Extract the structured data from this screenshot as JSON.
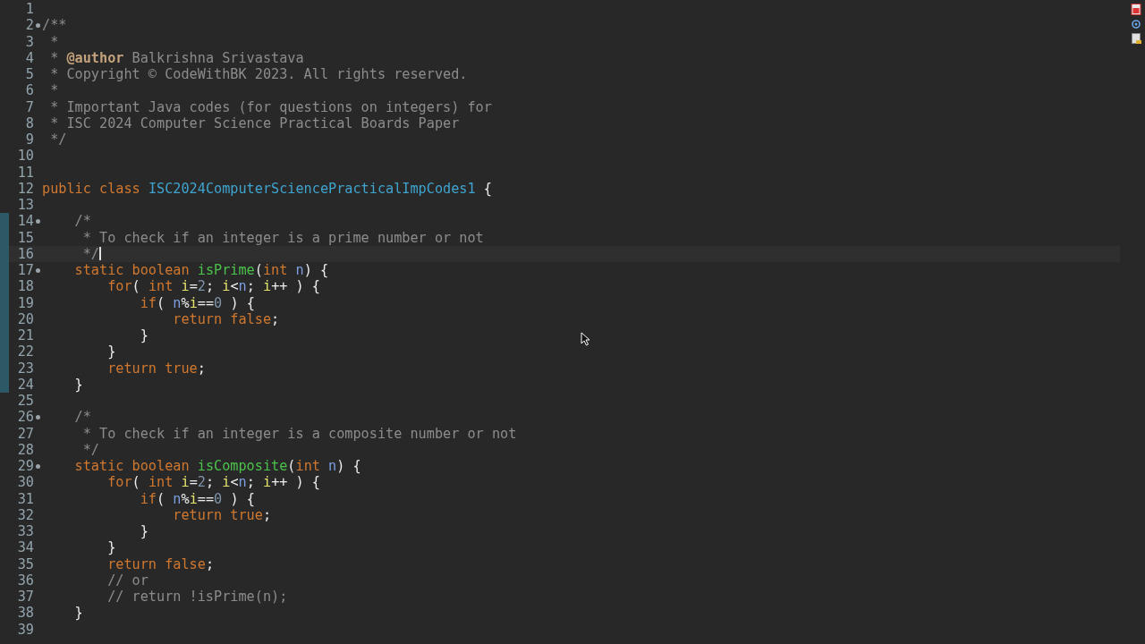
{
  "editor": {
    "lines": [
      {
        "number": "1",
        "fold": false,
        "changed": false,
        "current": false
      },
      {
        "number": "2",
        "tokens": [
          {
            "kind": "comment",
            "text": "/**"
          }
        ],
        "fold": true,
        "changed": false,
        "current": false
      },
      {
        "number": "3",
        "tokens": [
          {
            "kind": "comment",
            "text": " *"
          }
        ],
        "fold": false,
        "changed": false,
        "current": false
      },
      {
        "number": "4",
        "tokens": [
          {
            "kind": "comment",
            "text": " * "
          },
          {
            "kind": "tag",
            "text": "@author"
          },
          {
            "kind": "comment",
            "text": " Balkrishna Srivastava"
          }
        ],
        "fold": false,
        "changed": false,
        "current": false
      },
      {
        "number": "5",
        "tokens": [
          {
            "kind": "comment",
            "text": " * Copyright © CodeWithBK 2023. All rights reserved."
          }
        ],
        "fold": false,
        "changed": false,
        "current": false
      },
      {
        "number": "6",
        "tokens": [
          {
            "kind": "comment",
            "text": " *"
          }
        ],
        "fold": false,
        "changed": false,
        "current": false
      },
      {
        "number": "7",
        "tokens": [
          {
            "kind": "comment",
            "text": " * Important Java codes (for questions on integers) for"
          }
        ],
        "fold": false,
        "changed": false,
        "current": false
      },
      {
        "number": "8",
        "tokens": [
          {
            "kind": "comment",
            "text": " * ISC 2024 Computer Science Practical Boards Paper"
          }
        ],
        "fold": false,
        "changed": false,
        "current": false
      },
      {
        "number": "9",
        "tokens": [
          {
            "kind": "comment",
            "text": " */"
          }
        ],
        "fold": false,
        "changed": false,
        "current": false
      },
      {
        "number": "10",
        "fold": false,
        "changed": false,
        "current": false
      },
      {
        "number": "11",
        "fold": false,
        "changed": false,
        "current": false
      },
      {
        "number": "12",
        "tokens": [
          {
            "kind": "keyword",
            "text": "public class "
          },
          {
            "kind": "class",
            "text": "ISC2024ComputerSciencePracticalImpCodes1"
          },
          {
            "kind": "plain",
            "text": " {"
          }
        ],
        "fold": false,
        "changed": false,
        "current": false
      },
      {
        "number": "13",
        "fold": false,
        "changed": false,
        "current": false
      },
      {
        "number": "14",
        "tokens": [
          {
            "kind": "comment",
            "text": "    /*"
          }
        ],
        "fold": true,
        "changed": true,
        "current": false
      },
      {
        "number": "15",
        "tokens": [
          {
            "kind": "comment",
            "text": "     * To check if an integer is a prime number or not"
          }
        ],
        "fold": false,
        "changed": true,
        "current": false
      },
      {
        "number": "16",
        "tokens": [
          {
            "kind": "comment",
            "text": "     */"
          }
        ],
        "fold": false,
        "changed": true,
        "current": true
      },
      {
        "number": "17",
        "tokens": [
          {
            "kind": "keyword",
            "text": "    static boolean "
          },
          {
            "kind": "method",
            "text": "isPrime"
          },
          {
            "kind": "plain",
            "text": "("
          },
          {
            "kind": "keyword",
            "text": "int "
          },
          {
            "kind": "param",
            "text": "n"
          },
          {
            "kind": "plain",
            "text": ") {"
          }
        ],
        "fold": true,
        "changed": true,
        "current": false
      },
      {
        "number": "18",
        "tokens": [
          {
            "kind": "keyword",
            "text": "        for"
          },
          {
            "kind": "plain",
            "text": "( "
          },
          {
            "kind": "keyword",
            "text": "int "
          },
          {
            "kind": "local",
            "text": "i"
          },
          {
            "kind": "plain",
            "text": "="
          },
          {
            "kind": "number",
            "text": "2"
          },
          {
            "kind": "plain",
            "text": "; "
          },
          {
            "kind": "local",
            "text": "i"
          },
          {
            "kind": "plain",
            "text": "<"
          },
          {
            "kind": "param",
            "text": "n"
          },
          {
            "kind": "plain",
            "text": "; "
          },
          {
            "kind": "local",
            "text": "i"
          },
          {
            "kind": "plain",
            "text": "++ ) {"
          }
        ],
        "fold": false,
        "changed": true,
        "current": false
      },
      {
        "number": "19",
        "tokens": [
          {
            "kind": "keyword",
            "text": "            if"
          },
          {
            "kind": "plain",
            "text": "( "
          },
          {
            "kind": "param",
            "text": "n"
          },
          {
            "kind": "plain",
            "text": "%"
          },
          {
            "kind": "local",
            "text": "i"
          },
          {
            "kind": "plain",
            "text": "=="
          },
          {
            "kind": "number",
            "text": "0"
          },
          {
            "kind": "plain",
            "text": " ) {"
          }
        ],
        "fold": false,
        "changed": true,
        "current": false
      },
      {
        "number": "20",
        "tokens": [
          {
            "kind": "keyword",
            "text": "                return false"
          },
          {
            "kind": "plain",
            "text": ";"
          }
        ],
        "fold": false,
        "changed": true,
        "current": false
      },
      {
        "number": "21",
        "tokens": [
          {
            "kind": "plain",
            "text": "            }"
          }
        ],
        "fold": false,
        "changed": true,
        "current": false
      },
      {
        "number": "22",
        "tokens": [
          {
            "kind": "plain",
            "text": "        }"
          }
        ],
        "fold": false,
        "changed": true,
        "current": false
      },
      {
        "number": "23",
        "tokens": [
          {
            "kind": "keyword",
            "text": "        return true"
          },
          {
            "kind": "plain",
            "text": ";"
          }
        ],
        "fold": false,
        "changed": true,
        "current": false
      },
      {
        "number": "24",
        "tokens": [
          {
            "kind": "plain",
            "text": "    }"
          }
        ],
        "fold": false,
        "changed": true,
        "current": false
      },
      {
        "number": "25",
        "fold": false,
        "changed": false,
        "current": false
      },
      {
        "number": "26",
        "tokens": [
          {
            "kind": "comment",
            "text": "    /*"
          }
        ],
        "fold": true,
        "changed": false,
        "current": false
      },
      {
        "number": "27",
        "tokens": [
          {
            "kind": "comment",
            "text": "     * To check if an integer is a composite number or not"
          }
        ],
        "fold": false,
        "changed": false,
        "current": false
      },
      {
        "number": "28",
        "tokens": [
          {
            "kind": "comment",
            "text": "     */"
          }
        ],
        "fold": false,
        "changed": false,
        "current": false
      },
      {
        "number": "29",
        "tokens": [
          {
            "kind": "keyword",
            "text": "    static boolean "
          },
          {
            "kind": "method",
            "text": "isComposite"
          },
          {
            "kind": "plain",
            "text": "("
          },
          {
            "kind": "keyword",
            "text": "int "
          },
          {
            "kind": "param",
            "text": "n"
          },
          {
            "kind": "plain",
            "text": ") {"
          }
        ],
        "fold": true,
        "changed": false,
        "current": false
      },
      {
        "number": "30",
        "tokens": [
          {
            "kind": "keyword",
            "text": "        for"
          },
          {
            "kind": "plain",
            "text": "( "
          },
          {
            "kind": "keyword",
            "text": "int "
          },
          {
            "kind": "local",
            "text": "i"
          },
          {
            "kind": "plain",
            "text": "="
          },
          {
            "kind": "number",
            "text": "2"
          },
          {
            "kind": "plain",
            "text": "; "
          },
          {
            "kind": "local",
            "text": "i"
          },
          {
            "kind": "plain",
            "text": "<"
          },
          {
            "kind": "param",
            "text": "n"
          },
          {
            "kind": "plain",
            "text": "; "
          },
          {
            "kind": "local",
            "text": "i"
          },
          {
            "kind": "plain",
            "text": "++ ) {"
          }
        ],
        "fold": false,
        "changed": false,
        "current": false
      },
      {
        "number": "31",
        "tokens": [
          {
            "kind": "keyword",
            "text": "            if"
          },
          {
            "kind": "plain",
            "text": "( "
          },
          {
            "kind": "param",
            "text": "n"
          },
          {
            "kind": "plain",
            "text": "%"
          },
          {
            "kind": "local",
            "text": "i"
          },
          {
            "kind": "plain",
            "text": "=="
          },
          {
            "kind": "number",
            "text": "0"
          },
          {
            "kind": "plain",
            "text": " ) {"
          }
        ],
        "fold": false,
        "changed": false,
        "current": false
      },
      {
        "number": "32",
        "tokens": [
          {
            "kind": "keyword",
            "text": "                return true"
          },
          {
            "kind": "plain",
            "text": ";"
          }
        ],
        "fold": false,
        "changed": false,
        "current": false
      },
      {
        "number": "33",
        "tokens": [
          {
            "kind": "plain",
            "text": "            }"
          }
        ],
        "fold": false,
        "changed": false,
        "current": false
      },
      {
        "number": "34",
        "tokens": [
          {
            "kind": "plain",
            "text": "        }"
          }
        ],
        "fold": false,
        "changed": false,
        "current": false
      },
      {
        "number": "35",
        "tokens": [
          {
            "kind": "keyword",
            "text": "        return false"
          },
          {
            "kind": "plain",
            "text": ";"
          }
        ],
        "fold": false,
        "changed": false,
        "current": false
      },
      {
        "number": "36",
        "tokens": [
          {
            "kind": "comment",
            "text": "        // or"
          }
        ],
        "fold": false,
        "changed": false,
        "current": false
      },
      {
        "number": "37",
        "tokens": [
          {
            "kind": "comment",
            "text": "        // return !isPrime(n);"
          }
        ],
        "fold": false,
        "changed": false,
        "current": false
      },
      {
        "number": "38",
        "tokens": [
          {
            "kind": "plain",
            "text": "    }"
          }
        ],
        "fold": false,
        "changed": false,
        "current": false
      },
      {
        "number": "39",
        "fold": false,
        "changed": false,
        "current": false
      }
    ]
  }
}
